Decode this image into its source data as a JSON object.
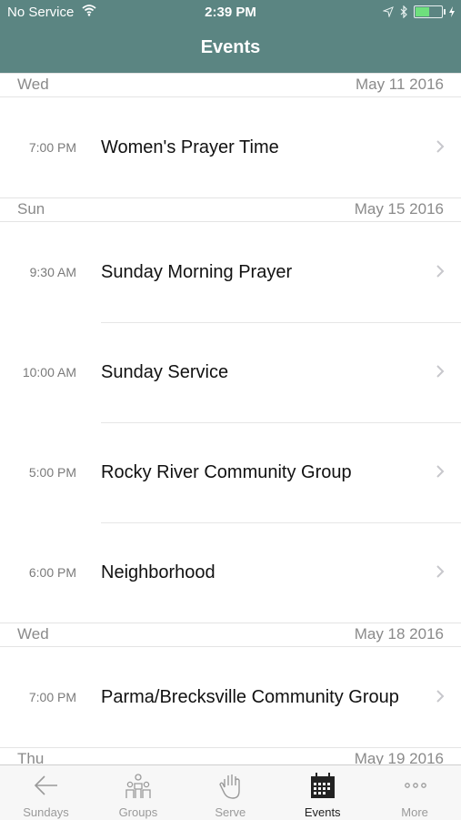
{
  "status_bar": {
    "carrier": "No Service",
    "time": "2:39 PM",
    "battery_level": 0.55
  },
  "nav": {
    "title": "Events"
  },
  "sections": [
    {
      "day": "Wed",
      "date": "May 11 2016",
      "events": [
        {
          "time": "7:00 PM",
          "name": "Women's Prayer Time"
        }
      ]
    },
    {
      "day": "Sun",
      "date": "May 15 2016",
      "events": [
        {
          "time": "9:30 AM",
          "name": "Sunday Morning Prayer"
        },
        {
          "time": "10:00 AM",
          "name": "Sunday Service"
        },
        {
          "time": "5:00 PM",
          "name": "Rocky River Community Group"
        },
        {
          "time": "6:00 PM",
          "name": "Neighborhood"
        }
      ]
    },
    {
      "day": "Wed",
      "date": "May 18 2016",
      "events": [
        {
          "time": "7:00 PM",
          "name": "Parma/Brecksville Community Group"
        }
      ]
    },
    {
      "day": "Thu",
      "date": "May 19 2016",
      "events": []
    }
  ],
  "tabs": [
    {
      "label": "Sundays",
      "icon": "back-arrow-icon"
    },
    {
      "label": "Groups",
      "icon": "people-icon"
    },
    {
      "label": "Serve",
      "icon": "hand-icon"
    },
    {
      "label": "Events",
      "icon": "calendar-icon",
      "active": true
    },
    {
      "label": "More",
      "icon": "more-dots-icon"
    }
  ],
  "colors": {
    "nav_bar": "#5b8582",
    "tab_active": "#222222",
    "tab_inactive": "#9a9a9a"
  }
}
